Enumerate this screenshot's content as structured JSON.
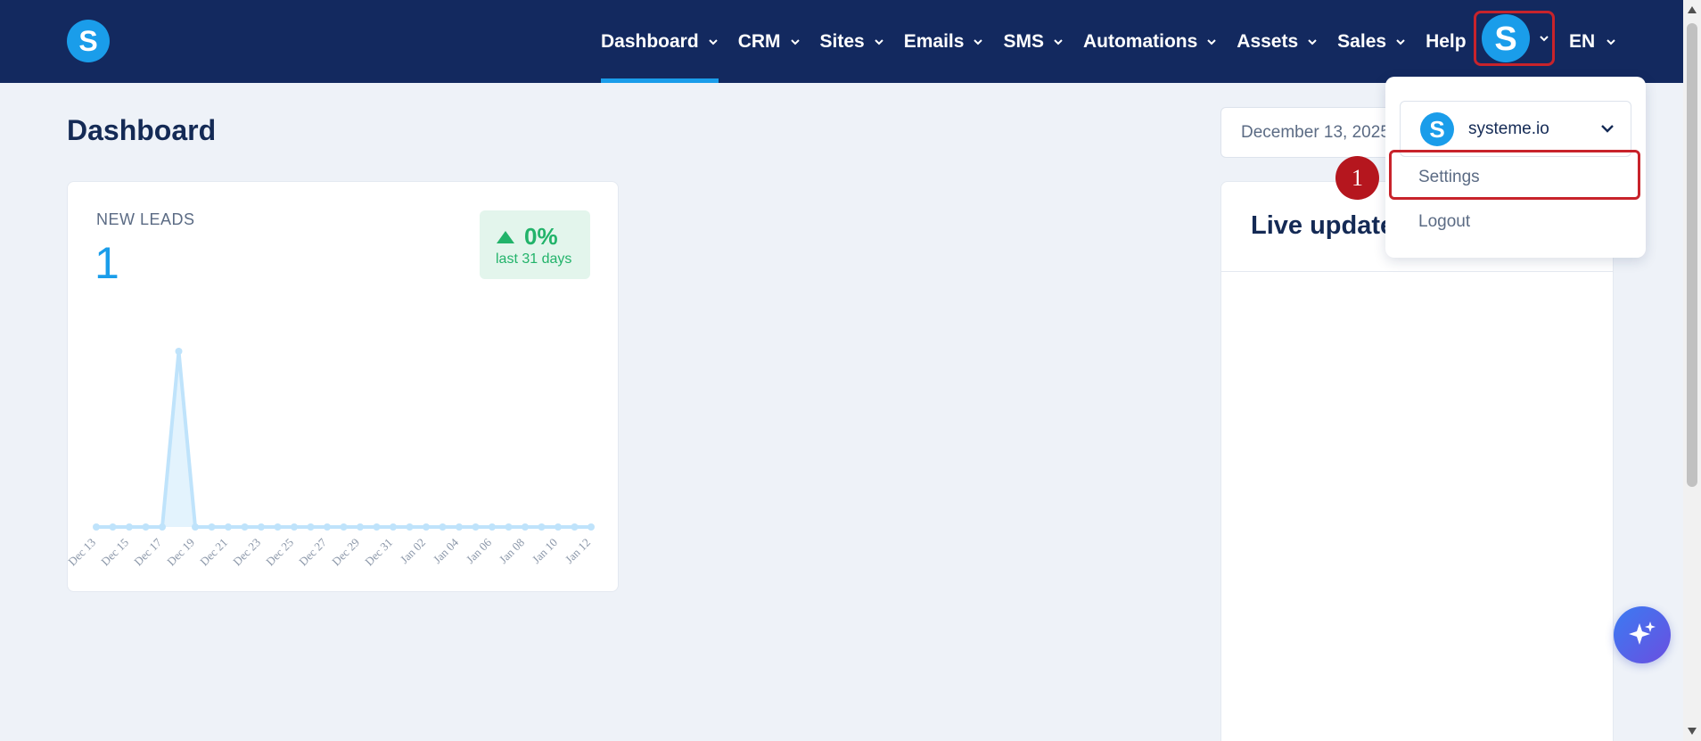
{
  "nav": {
    "items": [
      {
        "label": "Dashboard",
        "active": true
      },
      {
        "label": "CRM"
      },
      {
        "label": "Sites"
      },
      {
        "label": "Emails"
      },
      {
        "label": "SMS"
      },
      {
        "label": "Automations"
      },
      {
        "label": "Assets"
      },
      {
        "label": "Sales"
      }
    ],
    "help_label": "Help",
    "lang_label": "EN"
  },
  "page": {
    "title": "Dashboard",
    "date_range": "December 13, 2025"
  },
  "leads_card": {
    "label": "NEW LEADS",
    "value": "1",
    "trend_pct": "0%",
    "trend_period": "last 31 days"
  },
  "chart_data": {
    "type": "area",
    "categories": [
      "Dec 13",
      "Dec 14",
      "Dec 15",
      "Dec 16",
      "Dec 17",
      "Dec 18",
      "Dec 19",
      "Dec 20",
      "Dec 21",
      "Dec 22",
      "Dec 23",
      "Dec 24",
      "Dec 25",
      "Dec 26",
      "Dec 27",
      "Dec 28",
      "Dec 29",
      "Dec 30",
      "Dec 31",
      "Jan 01",
      "Jan 02",
      "Jan 03",
      "Jan 04",
      "Jan 05",
      "Jan 06",
      "Jan 07",
      "Jan 08",
      "Jan 09",
      "Jan 10",
      "Jan 11",
      "Jan 12"
    ],
    "tick_labels": [
      "Dec 13",
      "Dec 15",
      "Dec 17",
      "Dec 19",
      "Dec 21",
      "Dec 23",
      "Dec 25",
      "Dec 27",
      "Dec 29",
      "Dec 31",
      "Jan 02",
      "Jan 04",
      "Jan 06",
      "Jan 08",
      "Jan 10",
      "Jan 12"
    ],
    "values": [
      0,
      0,
      0,
      0,
      0,
      1,
      0,
      0,
      0,
      0,
      0,
      0,
      0,
      0,
      0,
      0,
      0,
      0,
      0,
      0,
      0,
      0,
      0,
      0,
      0,
      0,
      0,
      0,
      0,
      0,
      0
    ],
    "ylim": [
      0,
      1
    ],
    "color": "#bfe3fb"
  },
  "live": {
    "title": "Live updates"
  },
  "account_menu": {
    "account_name": "systeme.io",
    "items": [
      {
        "label": "Settings",
        "highlighted": true
      },
      {
        "label": "Logout"
      }
    ],
    "step_number": "1"
  },
  "colors": {
    "nav_bg": "#13295f",
    "brand_blue": "#1a9dea",
    "highlight_red": "#c8232b",
    "trend_green": "#22b36a"
  }
}
